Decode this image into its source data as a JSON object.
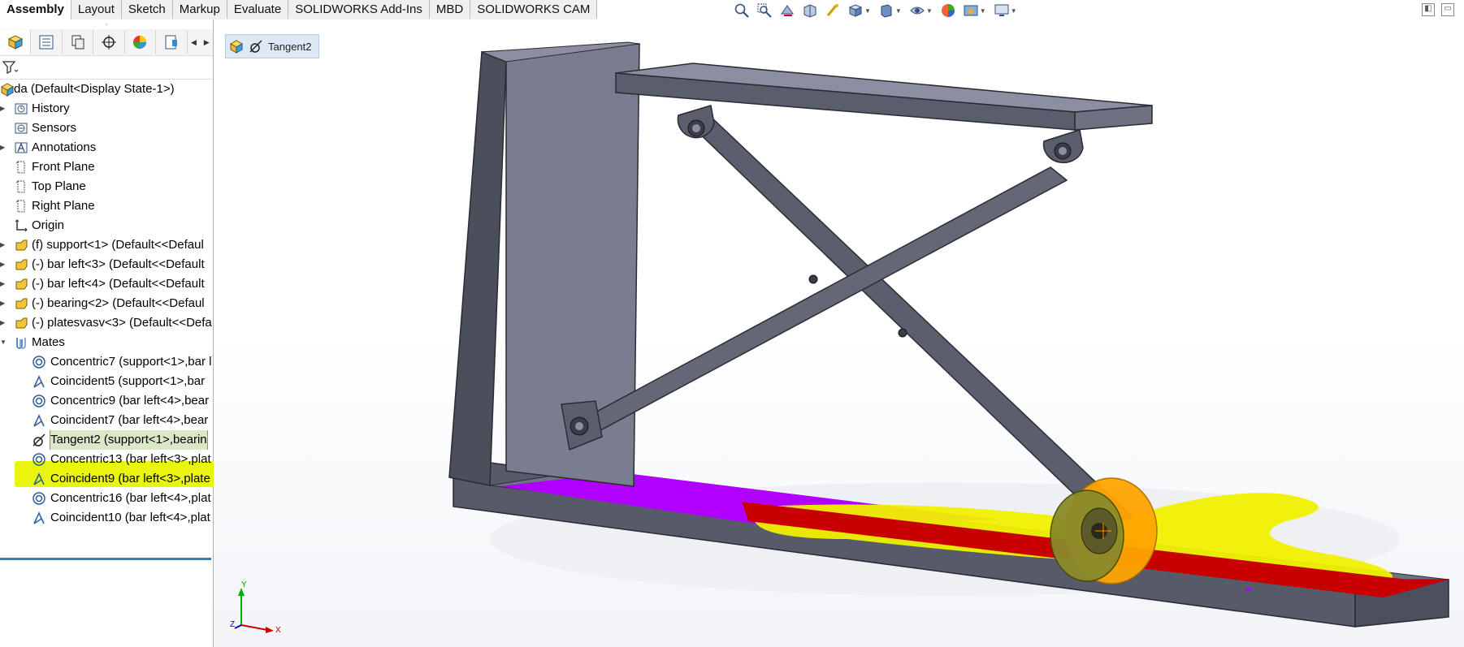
{
  "tabs": [
    "Assembly",
    "Layout",
    "Sketch",
    "Markup",
    "Evaluate",
    "SOLIDWORKS Add-Ins",
    "MBD",
    "SOLIDWORKS CAM"
  ],
  "active_tab": "Assembly",
  "breadcrumb": {
    "label": "Tangent2"
  },
  "tree": {
    "root": "da  (Default<Display State-1>)",
    "items": [
      {
        "label": "History",
        "icon": "history-icon"
      },
      {
        "label": "Sensors",
        "icon": "sensors-icon"
      },
      {
        "label": "Annotations",
        "icon": "annotations-icon"
      },
      {
        "label": "Front Plane",
        "icon": "plane-icon"
      },
      {
        "label": "Top Plane",
        "icon": "plane-icon"
      },
      {
        "label": "Right Plane",
        "icon": "plane-icon"
      },
      {
        "label": "Origin",
        "icon": "origin-icon"
      },
      {
        "label": "(f) support<1> (Default<<Defaul",
        "icon": "part-icon"
      },
      {
        "label": "(-) bar left<3> (Default<<Default",
        "icon": "part-icon"
      },
      {
        "label": "(-) bar left<4> (Default<<Default",
        "icon": "part-icon"
      },
      {
        "label": "(-) bearing<2> (Default<<Defaul",
        "icon": "part-icon"
      },
      {
        "label": "(-) platesvasv<3> (Default<<Defa",
        "icon": "part-icon"
      },
      {
        "label": "Mates",
        "icon": "mates-icon"
      }
    ],
    "mates": [
      {
        "label": "Concentric7 (support<1>,bar l",
        "icon": "concentric-icon"
      },
      {
        "label": "Coincident5 (support<1>,bar",
        "icon": "coincident-icon"
      },
      {
        "label": "Concentric9 (bar left<4>,bear",
        "icon": "concentric-icon"
      },
      {
        "label": "Coincident7 (bar left<4>,bear",
        "icon": "coincident-icon"
      },
      {
        "label": "Tangent2 (support<1>,bearin",
        "icon": "tangent-icon",
        "selected": true
      },
      {
        "label": "Concentric13 (bar left<3>,plat",
        "icon": "concentric-icon"
      },
      {
        "label": "Coincident9 (bar left<3>,plate",
        "icon": "coincident-icon"
      },
      {
        "label": "Concentric16 (bar left<4>,plat",
        "icon": "concentric-icon"
      },
      {
        "label": "Coincident10 (bar left<4>,plat",
        "icon": "coincident-icon"
      }
    ]
  },
  "triad": {
    "x": "X",
    "y": "Y",
    "z": "Z"
  },
  "colors": {
    "highlight_yellow": "#e8f400",
    "face_purple": "#b000ff",
    "face_red": "#c80000",
    "bearing_orange": "#ffa500",
    "metal_gray": "#6f7284",
    "selection_blue": "#2f7fc2"
  }
}
